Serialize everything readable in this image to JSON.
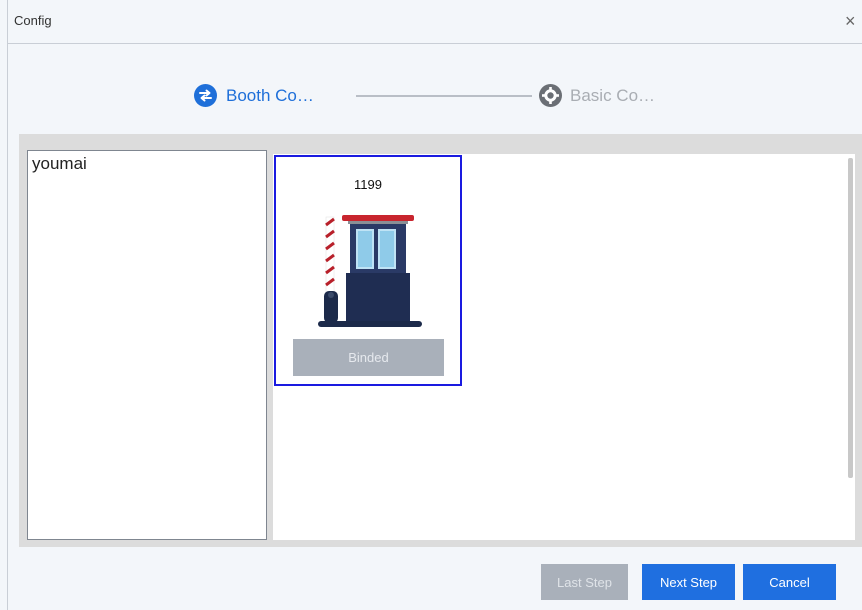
{
  "dialog": {
    "title": "Config",
    "close_glyph": "×"
  },
  "stepper": {
    "step1": {
      "label": "Booth Co…",
      "icon": "swap-arrows-icon",
      "color": "#1e6fd9"
    },
    "step2": {
      "label": "Basic Co…",
      "icon": "gear-icon",
      "color": "#a9adb3"
    }
  },
  "left_list": {
    "items": [
      "youmai"
    ]
  },
  "booths": [
    {
      "id": "1199",
      "status": "Binded",
      "icon": "toll-booth-icon",
      "selected": true
    }
  ],
  "footer": {
    "last_step": "Last Step",
    "next_step": "Next Step",
    "cancel": "Cancel"
  },
  "colors": {
    "accent": "#1f6fe0",
    "selection_border": "#1a1ae0",
    "disabled": "#a9b0ba"
  }
}
